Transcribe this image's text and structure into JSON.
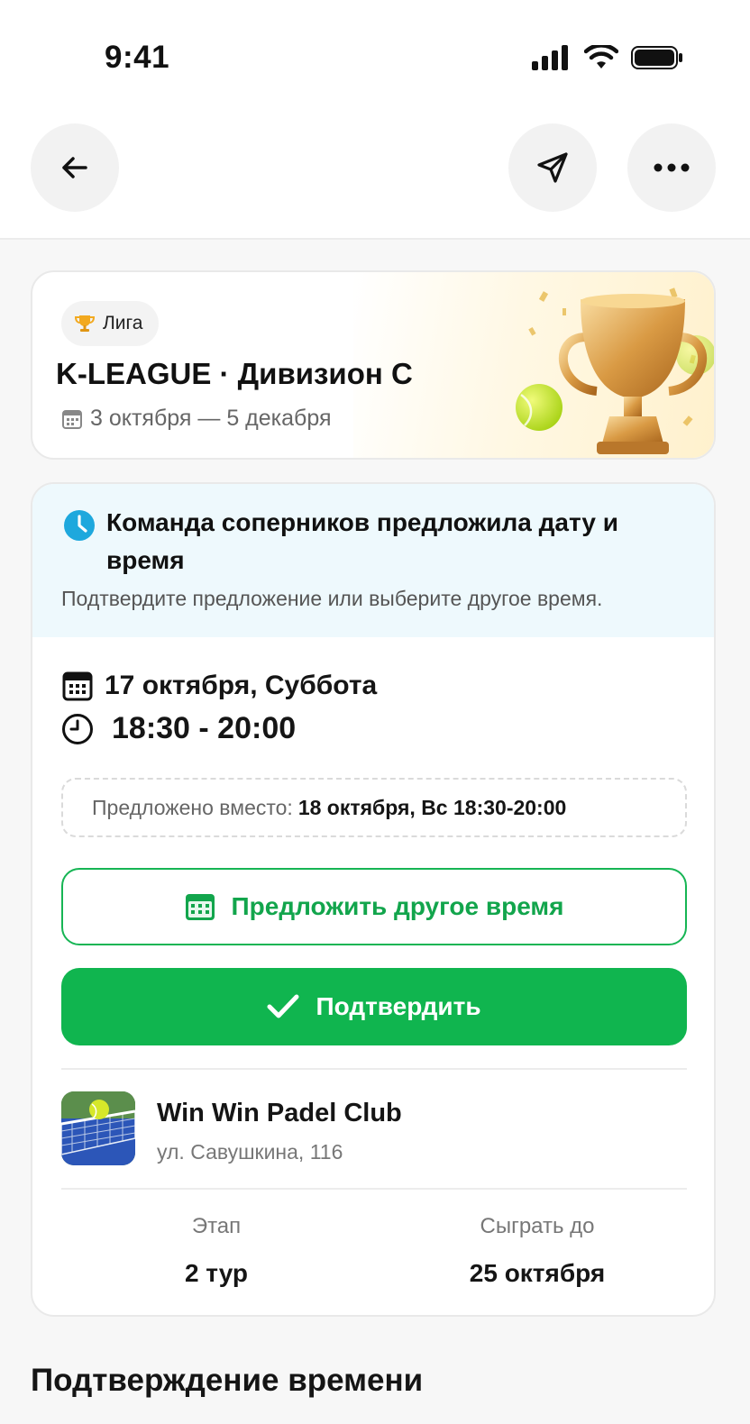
{
  "status_bar": {
    "time": "9:41"
  },
  "header": {
    "back_icon": "arrow-left-icon",
    "share_icon": "send-icon",
    "more_icon": "more-horizontal-icon"
  },
  "league": {
    "badge": "Лига",
    "title": "K-LEAGUE · Дивизион C",
    "dates": "3 октября — 5 декабря"
  },
  "offer": {
    "title": "Команда соперников предложила дату и время",
    "subtitle": "Подтвердите предложение или выберите другое время.",
    "date": "17 октября, Суббота",
    "time": "18:30 - 20:00",
    "instead_label": "Предложено вместо:",
    "instead_value": "18 октября, Вс 18:30-20:00",
    "propose_label": "Предложить другое время",
    "confirm_label": "Подтвердить"
  },
  "club": {
    "name": "Win Win Padel Club",
    "address": "ул. Савушкина, 116"
  },
  "stats": {
    "stage_label": "Этап",
    "stage_value": "2 тур",
    "deadline_label": "Сыграть до",
    "deadline_value": "25 октября"
  },
  "section": {
    "title": "Подтверждение времени"
  },
  "colors": {
    "accent": "#10b54f",
    "info": "#1ea8dd",
    "banner_bg": "#eef9fd"
  }
}
